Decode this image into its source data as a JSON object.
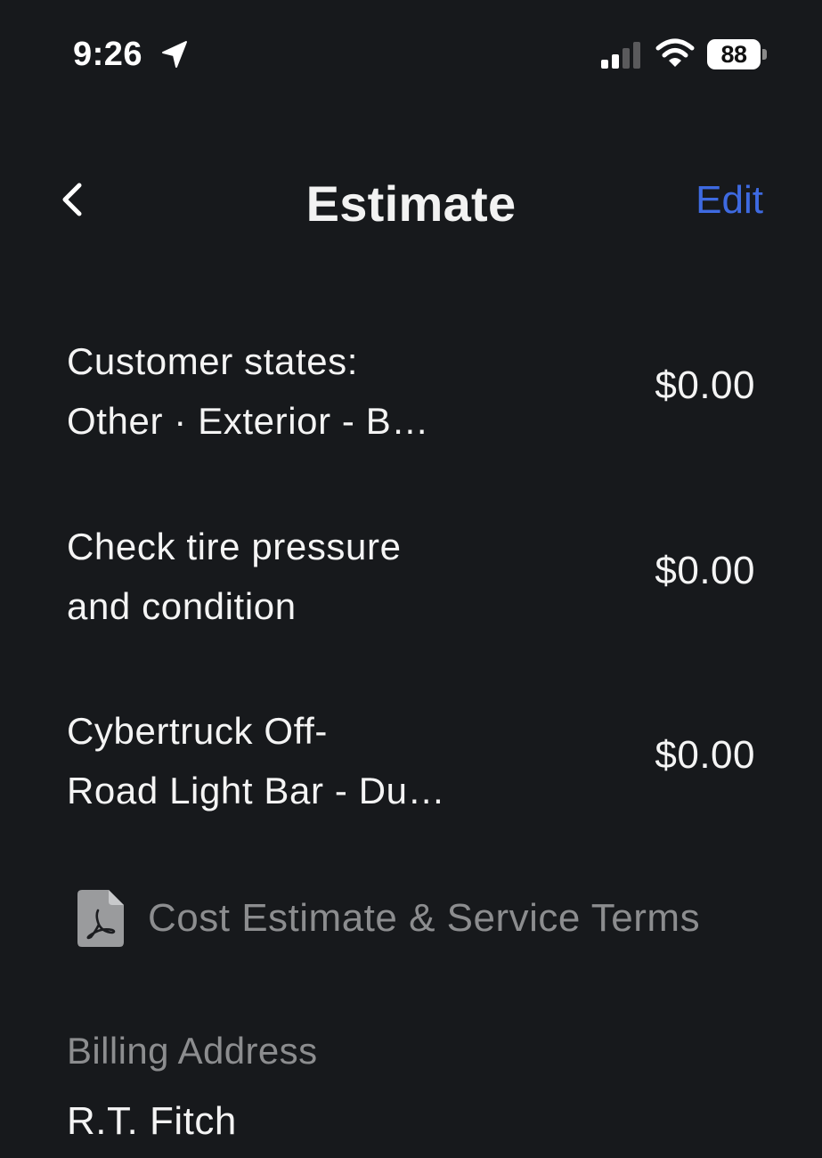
{
  "status_bar": {
    "time": "9:26",
    "battery_level": "88",
    "icons": [
      "location-arrow-icon",
      "cellular-signal-icon",
      "wifi-icon",
      "battery-icon"
    ]
  },
  "nav": {
    "back_icon": "chevron-left-icon",
    "title": "Estimate",
    "edit_label": "Edit"
  },
  "line_items": [
    {
      "line1": "Customer states:",
      "line2": "Other · Exterior - B…",
      "price": "$0.00"
    },
    {
      "line1": "Check tire pressure",
      "line2": "and condition",
      "price": "$0.00"
    },
    {
      "line1": "Cybertruck Off-",
      "line2": "Road Light Bar - Du…",
      "price": "$0.00"
    }
  ],
  "terms": {
    "icon": "pdf-document-icon",
    "label": "Cost Estimate & Service Terms"
  },
  "billing": {
    "heading": "Billing Address",
    "name": "R.T. Fitch"
  },
  "colors": {
    "background": "#17191c",
    "accent": "#3e6ae1",
    "primary_text": "#f4f4f4",
    "secondary_text": "#8c8d8f"
  }
}
